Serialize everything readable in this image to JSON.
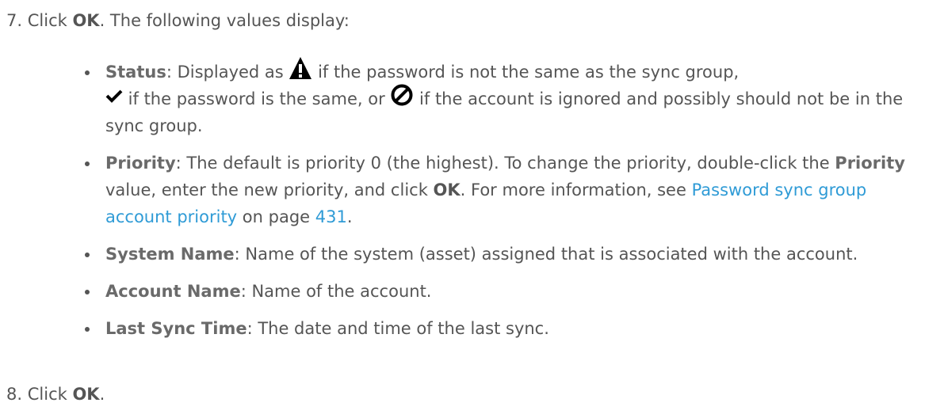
{
  "step7": {
    "number": "7.",
    "text_before": "Click ",
    "ok": "OK",
    "text_after": ". The following values display:"
  },
  "bullets": {
    "status": {
      "term": "Status",
      "sep": ": ",
      "t1": "Displayed as ",
      "t2": " if the password is not the same as the sync group,",
      "t3": " if the password is the same, or ",
      "t4": " if the account is ignored and possibly should not be in the sync group.",
      "icons": [
        "warning-icon",
        "checkmark-icon",
        "prohibited-icon"
      ]
    },
    "priority": {
      "term": "Priority",
      "t1": ": The default is priority 0 (the highest). To change the priority, double-click the ",
      "term2": "Priority",
      "t2": " value, enter the new priority, and click ",
      "ok": "OK",
      "t3": ". For more information, see ",
      "link_text": "Password sync group account priority",
      "t4": " on page ",
      "page": "431",
      "t5": "."
    },
    "system_name": {
      "term": "System Name",
      "desc": ": Name of the system (asset) assigned that is associated with the account."
    },
    "account_name": {
      "term": "Account Name",
      "desc": ": Name of the account."
    },
    "last_sync_time": {
      "term": "Last Sync Time",
      "desc": ": The date and time of the last sync."
    }
  },
  "step8": {
    "number": "8.",
    "text_before": "Click ",
    "ok": "OK",
    "text_after": "."
  },
  "colors": {
    "text": "#555555",
    "link": "#2f9bd6",
    "icon": "#000000"
  }
}
